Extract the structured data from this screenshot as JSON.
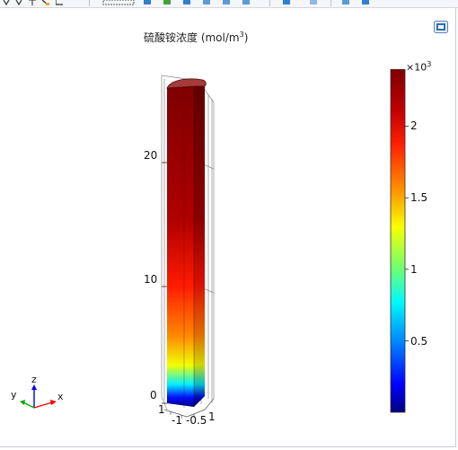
{
  "toolbar": {
    "icons": [
      "camera-icon",
      "zoom-box-icon",
      "zoom-extents-icon",
      "scene-light-icon",
      "transparency-icon",
      "grid-icon",
      "axes-icon",
      "render-icon",
      "print-icon",
      "export-icon"
    ]
  },
  "plot": {
    "title_text": "硫酸铵浓度 (mol/m",
    "title_sup": "3",
    "title_close": ")",
    "z_ticks": [
      "0",
      "10",
      "20"
    ],
    "base_ticks": [
      "1",
      "-1",
      "-0.5",
      "1"
    ],
    "colors": {
      "top_cap": "#a63b3b",
      "dark_red": "#7f0000",
      "red": "#ff1a00",
      "orange": "#ff8a00",
      "yellow": "#f0ff00",
      "cyan": "#00f0ff",
      "blue": "#0010ff",
      "navy": "#000080"
    }
  },
  "colorbar": {
    "exponent_base": "×10",
    "exponent_power": "3",
    "ticks": [
      "2",
      "1.5",
      "1",
      "0.5"
    ],
    "tick_values": [
      2,
      1.5,
      1,
      0.5
    ],
    "min": 0,
    "max": 2.4
  },
  "triad": {
    "x_label": "x",
    "y_label": "y",
    "z_label": "z"
  }
}
